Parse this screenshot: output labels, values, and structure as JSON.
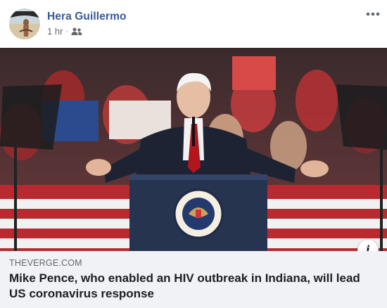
{
  "post": {
    "author_name": "Hera Guillermo",
    "timestamp": "1 hr",
    "separator": "·",
    "audience_icon": "friends-icon",
    "more_icon": "more-options-icon"
  },
  "link_preview": {
    "image_description_icon": "info-icon",
    "info_label": "i",
    "domain": "THEVERGE.COM",
    "headline": "Mike Pence, who enabled an HIV outbreak in Indiana, will lead US coronavirus response"
  },
  "colors": {
    "author_link": "#385898",
    "meta_text": "#65676b",
    "caption_bg": "#f0f2f5",
    "headline_text": "#1c1e21"
  }
}
